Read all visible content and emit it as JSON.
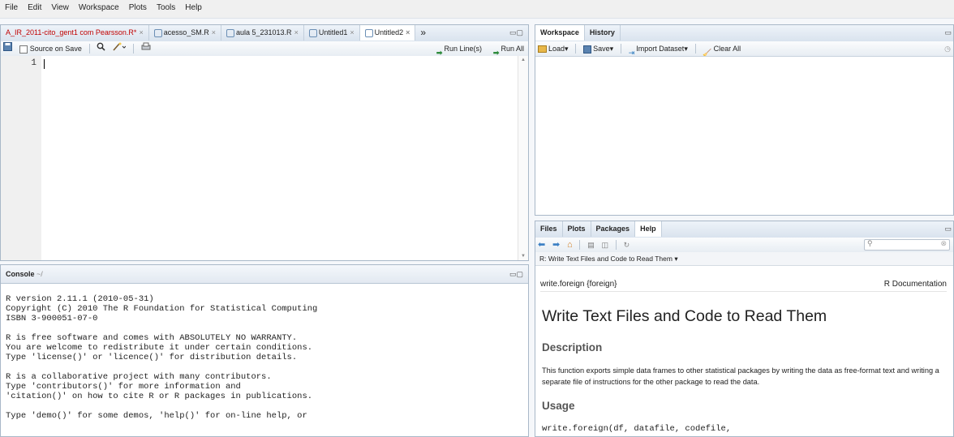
{
  "menu": [
    "File",
    "Edit",
    "View",
    "Workspace",
    "Plots",
    "Tools",
    "Help"
  ],
  "source": {
    "tabs": [
      {
        "label": "A_IR_2011-cito_gent1 com Pearsson.R*",
        "modified": true
      },
      {
        "label": "acesso_SM.R"
      },
      {
        "label": "aula 5_231013.R"
      },
      {
        "label": "Untitled1"
      },
      {
        "label": "Untitled2",
        "active": true
      }
    ],
    "overflow": "»",
    "source_on_save": "Source on Save",
    "run_lines": "Run Line(s)",
    "run_all": "Run All",
    "line_number": "1"
  },
  "console": {
    "title": "Console",
    "path": "~/",
    "lines": [
      "R version 2.11.1 (2010-05-31)",
      "Copyright (C) 2010 The R Foundation for Statistical Computing",
      "ISBN 3-900051-07-0",
      "",
      "R is free software and comes with ABSOLUTELY NO WARRANTY.",
      "You are welcome to redistribute it under certain conditions.",
      "Type 'license()' or 'licence()' for distribution details.",
      "",
      "R is a collaborative project with many contributors.",
      "Type 'contributors()' for more information and",
      "'citation()' on how to cite R or R packages in publications.",
      "",
      "Type 'demo()' for some demos, 'help()' for on-line help, or"
    ]
  },
  "workspace": {
    "tabs": [
      "Workspace",
      "History"
    ],
    "load": "Load",
    "save": "Save",
    "import": "Import Dataset",
    "clear": "Clear All"
  },
  "help": {
    "tabs": [
      "Files",
      "Plots",
      "Packages",
      "Help"
    ],
    "topic": "R: Write Text Files and Code to Read Them",
    "pkg": "write.foreign {foreign}",
    "rdoc": "R Documentation",
    "title": "Write Text Files and Code to Read Them",
    "desc_h": "Description",
    "desc": "This function exports simple data frames to other statistical packages by writing the data as free-format text and writing a separate file of instructions for the other package to read the data.",
    "usage_h": "Usage",
    "usage": "write.foreign(df, datafile, codefile,"
  },
  "colors": {
    "accent": "#3a6ea5",
    "modified_tab": "#cc0000",
    "heading": "#555555"
  }
}
